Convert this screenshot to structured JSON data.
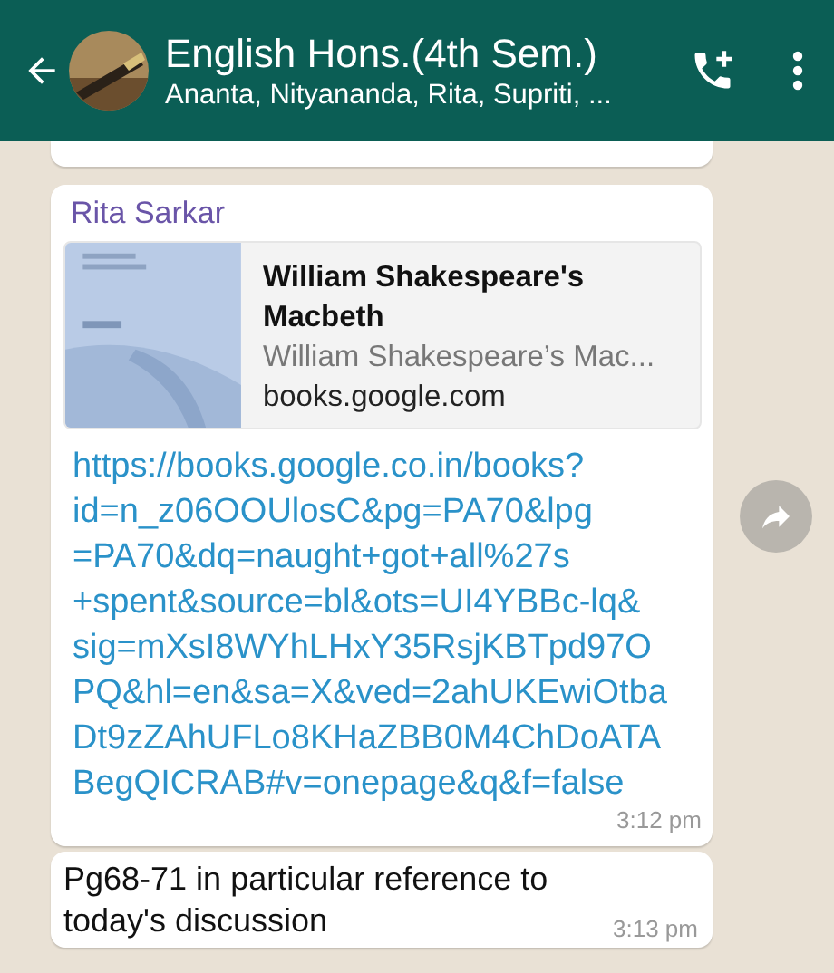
{
  "header": {
    "title": "English Hons.(4th Sem.)",
    "subtitle": "Ananta, Nityananda, Rita, Supriti, ..."
  },
  "messages": [
    {
      "kind": "cut"
    },
    {
      "kind": "link",
      "sender": "Rita Sarkar",
      "preview": {
        "title": "William Shakespeare's Macbeth",
        "description": "William Shakespeare’s Mac...",
        "domain": "books.google.com"
      },
      "url_lines": [
        "https://books.google.co.in/books?",
        "id=n_z06OOUlosC&pg=PA70&lpg",
        "=PA70&dq=naught+got+all%27s",
        "+spent&source=bl&ots=UI4YBBc-lq&",
        "sig=mXsI8WYhLHxY35RsjKBTpd97O",
        "PQ&hl=en&sa=X&ved=2ahUKEwiOtba",
        "Dt9zZAhUFLo8KHaZBB0M4ChDoATA",
        "BegQICRAB#v=onepage&q&f=false"
      ],
      "time": "3:12 pm"
    },
    {
      "kind": "text",
      "text": "Pg68-71 in particular reference to today's discussion",
      "time": "3:13 pm"
    }
  ]
}
